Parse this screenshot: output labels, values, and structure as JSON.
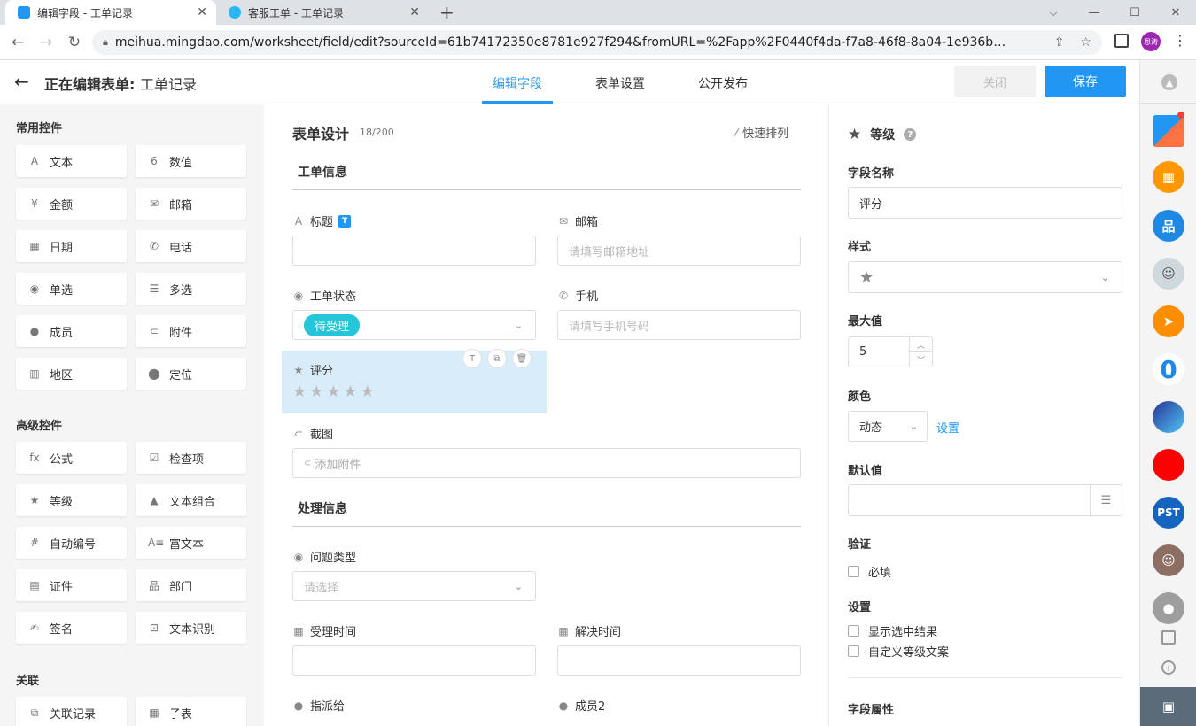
{
  "browser": {
    "tabs": [
      {
        "title": "编辑字段 - 工单记录"
      },
      {
        "title": "客服工单 - 工单记录"
      }
    ],
    "url": "meihua.mingdao.com/worksheet/field/edit?sourceId=61b74172350e8781e927f294&fromURL=%2Fapp%2F0440f4da-f7a8-46f8-8a04-1e936bfec443%2F...",
    "profile_label": "恩涛"
  },
  "header": {
    "prefix": "正在编辑表单:",
    "form_name": "工单记录",
    "tabs": [
      "编辑字段",
      "表单设置",
      "公开发布"
    ],
    "close_label": "关闭",
    "save_label": "保存"
  },
  "palette": {
    "common_title": "常用控件",
    "common": [
      {
        "label": "文本",
        "icon": "A"
      },
      {
        "label": "数值",
        "icon": "6"
      },
      {
        "label": "金额",
        "icon": "¥"
      },
      {
        "label": "邮箱",
        "icon": "✉"
      },
      {
        "label": "日期",
        "icon": "▦"
      },
      {
        "label": "电话",
        "icon": "✆"
      },
      {
        "label": "单选",
        "icon": "◉"
      },
      {
        "label": "多选",
        "icon": "☰"
      },
      {
        "label": "成员",
        "icon": "●"
      },
      {
        "label": "附件",
        "icon": "⊂"
      },
      {
        "label": "地区",
        "icon": "▥"
      },
      {
        "label": "定位",
        "icon": "⬤"
      }
    ],
    "advanced_title": "高级控件",
    "advanced": [
      {
        "label": "公式",
        "icon": "fx"
      },
      {
        "label": "检查项",
        "icon": "☑"
      },
      {
        "label": "等级",
        "icon": "★"
      },
      {
        "label": "文本组合",
        "icon": "▲"
      },
      {
        "label": "自动编号",
        "icon": "#"
      },
      {
        "label": "富文本",
        "icon": "A≡"
      },
      {
        "label": "证件",
        "icon": "▤"
      },
      {
        "label": "部门",
        "icon": "品"
      },
      {
        "label": "签名",
        "icon": "✍"
      },
      {
        "label": "文本识别",
        "icon": "⊡"
      }
    ],
    "relation_title": "关联",
    "relation": [
      {
        "label": "关联记录",
        "icon": "⧉"
      },
      {
        "label": "子表",
        "icon": "▦"
      }
    ]
  },
  "form": {
    "title": "表单设计",
    "count": "18/200",
    "quick_sort": "快速排列",
    "group1": "工单信息",
    "title_field": "标题",
    "title_badge": "T",
    "email_field": "邮箱",
    "email_placeholder": "请填写邮箱地址",
    "status_field": "工单状态",
    "status_value": "待受理",
    "phone_field": "手机",
    "phone_placeholder": "请填写手机号码",
    "rating_field": "评分",
    "rating_max": 5,
    "screenshot_field": "截图",
    "attach_placeholder": "添加附件",
    "group2": "处理信息",
    "issue_type_field": "问题类型",
    "issue_type_placeholder": "请选择",
    "accept_time_field": "受理时间",
    "resolve_time_field": "解决时间",
    "assign_field": "指派给",
    "member2_field": "成员2"
  },
  "settings": {
    "control_name": "等级",
    "field_name_label": "字段名称",
    "field_name_value": "评分",
    "style_label": "样式",
    "max_label": "最大值",
    "max_value": "5",
    "color_label": "颜色",
    "color_value": "动态",
    "color_link": "设置",
    "default_label": "默认值",
    "validate_label": "验证",
    "required_label": "必填",
    "setup_label": "设置",
    "show_selected_label": "显示选中结果",
    "custom_text_label": "自定义等级文案",
    "props_label": "字段属性"
  },
  "rail": {
    "pst_label": "PST"
  },
  "colors": {
    "accent": "#2196f3",
    "status_tag": "#26c6da",
    "selected_field_bg": "#d9ecfa"
  }
}
